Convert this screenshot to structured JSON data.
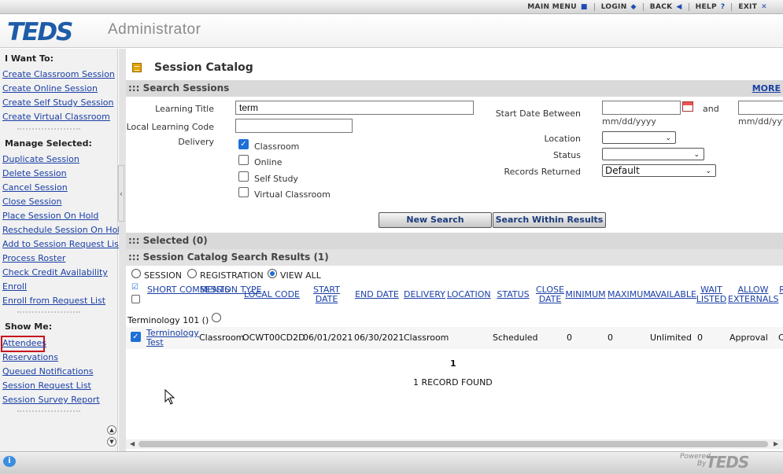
{
  "topnav": {
    "items": [
      {
        "label": "MAIN MENU",
        "icon": "square-icon"
      },
      {
        "label": "LOGIN",
        "icon": "diamond-icon"
      },
      {
        "label": "BACK",
        "icon": "triangle-left-icon"
      },
      {
        "label": "HELP",
        "icon": "question-icon"
      },
      {
        "label": "EXIT",
        "icon": "close-icon"
      }
    ]
  },
  "header": {
    "logo": "TEDS",
    "subtitle": "Administrator"
  },
  "sidebar": {
    "i_want_to": {
      "title": "I Want To:",
      "items": [
        "Create Classroom Session",
        "Create Online Session",
        "Create Self Study Session",
        "Create Virtual Classroom"
      ]
    },
    "manage_selected": {
      "title": "Manage Selected:",
      "items": [
        "Duplicate Session",
        "Delete Session",
        "Cancel Session",
        "Close Session",
        "Place Session On Hold",
        "Reschedule Session On Hold",
        "Add to Session Request List",
        "Process Roster",
        "Check Credit Availability",
        "Enroll",
        "Enroll from Request List"
      ]
    },
    "show_me": {
      "title": "Show Me:",
      "items": [
        "Attendees",
        "Reservations",
        "Queued Notifications",
        "Session Request List",
        "Session Survey Report"
      ]
    }
  },
  "main": {
    "title": "Session Catalog",
    "search_bar": {
      "title": "::: Search Sessions",
      "more": "MORE"
    },
    "form": {
      "learning_title": {
        "label": "Learning Title",
        "value": "term"
      },
      "local_code": {
        "label": "Local Learning Code",
        "value": ""
      },
      "delivery": {
        "label": "Delivery",
        "options": [
          {
            "label": "Classroom",
            "checked": true
          },
          {
            "label": "Online",
            "checked": false
          },
          {
            "label": "Self Study",
            "checked": false
          },
          {
            "label": "Virtual Classroom",
            "checked": false
          }
        ]
      },
      "start_date": {
        "label": "Start Date Between",
        "and": "and",
        "hint": "mm/dd/yyyy",
        "from": "",
        "to": ""
      },
      "location": {
        "label": "Location",
        "value": ""
      },
      "status": {
        "label": "Status",
        "value": ""
      },
      "records_returned": {
        "label": "Records Returned",
        "value": "Default"
      }
    },
    "buttons": {
      "new_search": "New Search",
      "search_within": "Search Within Results"
    },
    "selected_bar": "::: Selected (0)",
    "results_bar": "::: Session Catalog Search Results (1)",
    "view_options": [
      {
        "label": "SESSION",
        "selected": false
      },
      {
        "label": "REGISTRATION",
        "selected": false
      },
      {
        "label": "VIEW ALL",
        "selected": true
      }
    ],
    "columns": [
      "SHORT COMMENTS",
      "SESSION TYPE",
      "LOCAL CODE",
      "START DATE",
      "END DATE",
      "DELIVERY",
      "LOCATION",
      "STATUS",
      "CLOSE DATE",
      "MINIMUM",
      "MAXIMUM",
      "AVAILABLE",
      "WAIT LISTED",
      "ALLOW EXTERNALS",
      "R"
    ],
    "group_label": "Terminology 101 ()",
    "row": {
      "checked": true,
      "title_line1": "Terminology",
      "title_line2": "Test",
      "session_type": "Classroom",
      "local_code": "OCWT00CD2D",
      "start_date": "06/01/2021",
      "end_date": "06/30/2021",
      "delivery": "Classroom",
      "status": "Scheduled",
      "minimum": "0",
      "maximum": "0",
      "available": "Unlimited",
      "wait_listed": "0",
      "allow_externals": "Approval",
      "extra": "C"
    },
    "page_number": "1",
    "records_found": "1  RECORD FOUND"
  },
  "footer": {
    "powered": "Powered",
    "by": "By",
    "logo": "TEDS"
  }
}
